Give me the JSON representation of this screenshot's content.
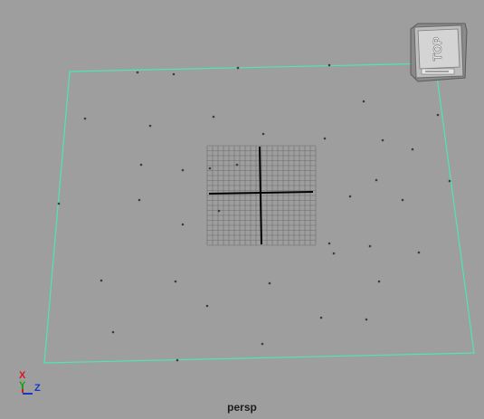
{
  "viewport": {
    "camera_name": "persp",
    "background_color": "#9e9e9e",
    "bounding_box_color": "#4fe6b0",
    "origin_grid_color": "#6d6d6d",
    "origin_axis_color": "#000000"
  },
  "view_cube": {
    "face_label": "TOP",
    "icon": "view-cube-icon"
  },
  "axis_indicator": {
    "x_label": "X",
    "y_label": "Y",
    "z_label": "Z",
    "x_color": "#d11b1b",
    "y_color": "#1aa31a",
    "z_color": "#1638c8"
  }
}
